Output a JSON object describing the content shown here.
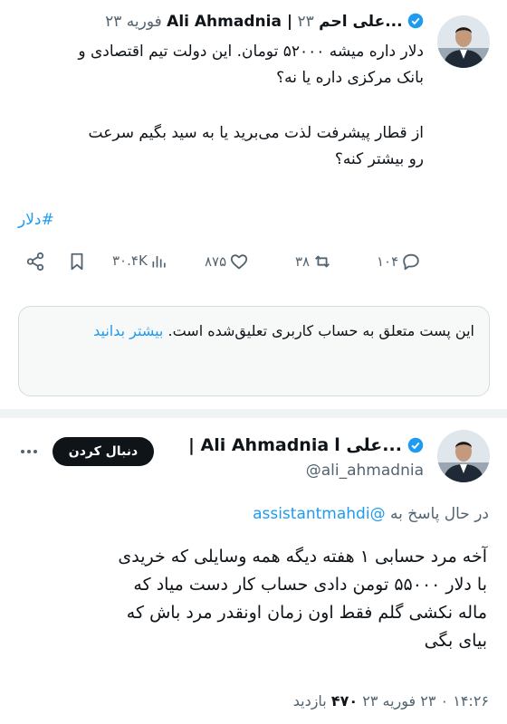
{
  "tweet": {
    "display_name_fa": "...علی احم",
    "display_name_en": "Ali Ahmadnia |",
    "date": "۲۳ فوریه ۲۳",
    "text_line1": "دلار داره میشه ۵۲۰۰۰ تومان. این دولت تیم اقتصادی و",
    "text_line2": "بانک مرکزی داره یا نه؟",
    "text_line3": "از قطار پیشرفت لذت می‌برید یا به سید بگیم سرعت",
    "text_line4": "رو بیشتر کنه؟",
    "hashtag": "#دلار",
    "views": "۳۰.۴K",
    "likes": "۸۷۵",
    "retweets": "۳۸",
    "replies": "۱۰۴"
  },
  "notice": {
    "text": "این پست متعلق به حساب کاربری تعلیق‌شده است.",
    "link": "بیشتر بدانید"
  },
  "reply": {
    "display_name_fa": "...علی ا",
    "display_name_en": "Ali Ahmadnia |",
    "handle": "@ali_ahmadnia",
    "follow_label": "دنبال کردن",
    "replying_prefix": "در حال پاسخ به",
    "replying_to": "@assistantmahdi",
    "text_line1": "آخه مرد حسابی ۱ هفته دیگه همه وسایلی که خریدی",
    "text_line2": "با دلار ۵۵۰۰۰ تومن دادی حساب کار دست میاد که",
    "text_line3": "ماله نکشی گلم فقط اون زمان اونقدر مرد باش که",
    "text_line4": "بیای بگی",
    "timestamp": "۱۴:۲۶ ۰ ۲۳ فوریه ۲۳",
    "views_count": "۴۷۰",
    "views_label": "بازدید"
  },
  "colors": {
    "accent": "#1d9bf0",
    "text": "#0f1419",
    "muted": "#536471"
  }
}
